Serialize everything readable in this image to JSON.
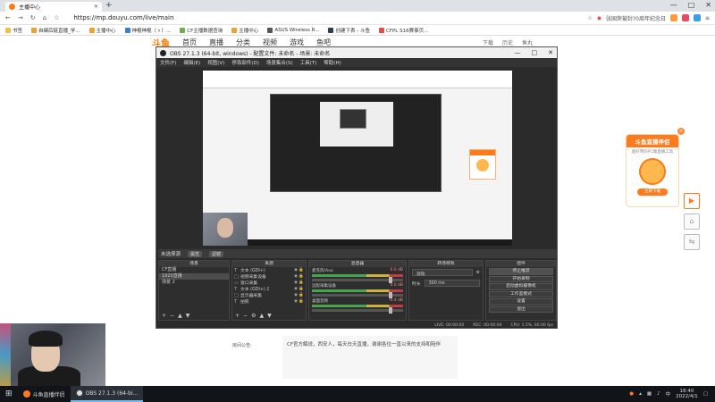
{
  "browser": {
    "tab_title": "主播中心",
    "new_tab": "+",
    "url": "https://mp.douyu.com/live/main",
    "right_text": "张国荣被封?0周年纪念日",
    "window_controls": [
      "—",
      "□",
      "✕"
    ],
    "bookmarks": [
      "书签",
      "自编后链直播_学...",
      "主播中心",
      "神棍神棍（ゝ）...",
      "CF主播数据查询",
      "主播中心",
      "ASUS Wireless R...",
      "创建下表 - 斗鱼",
      "CFPL S16赛事页..."
    ]
  },
  "douyu": {
    "logo": "斗鱼",
    "nav": [
      "首页",
      "直播",
      "分类",
      "视频",
      "游戏",
      "鱼吧"
    ],
    "user_links": [
      "下载",
      "历史",
      "鱼丸"
    ],
    "announcement_label": "房间公告:",
    "announcement_text": "CF官方解说，西安人，每天白天直播，谢谢各位一直以来的支持和陪伴",
    "side_ad_title": "斗鱼直播伴侣",
    "side_ad_sub": "超好用的PC端直播工具",
    "side_ad_btn": "立即下载",
    "side_ad_close": "×",
    "side_buttons": [
      "▶",
      "⌂",
      "⇆"
    ]
  },
  "obs": {
    "title": "OBS 27.1.3 (64-bit, windows) - 配置文件: 未命名 - 场景: 未命名",
    "controls": [
      "—",
      "□",
      "✕"
    ],
    "menu": [
      "文件(F)",
      "编辑(E)",
      "视图(V)",
      "停靠部件(D)",
      "场景集合(S)",
      "工具(T)",
      "帮助(H)"
    ],
    "status_label": "未选择源",
    "chips": [
      "属性",
      "滤镜"
    ],
    "scenes_title": "场景",
    "scenes": [
      "CF直播",
      "1920直播",
      "场景 2"
    ],
    "sources_title": "来源",
    "sources": [
      {
        "icon": "T",
        "name": "文本 (GDI+)"
      },
      {
        "icon": "□",
        "name": "视频采集设备"
      },
      {
        "icon": "▭",
        "name": "窗口采集"
      },
      {
        "icon": "T",
        "name": "文本 (GDI+) 2"
      },
      {
        "icon": "□",
        "name": "显示器采集"
      },
      {
        "icon": "T",
        "name": "拍照"
      }
    ],
    "mixer_title": "混音器",
    "mixer": [
      {
        "name": "麦克风/Aux",
        "db": "0.0 dB"
      },
      {
        "name": "远程采集设备",
        "db": "0.0 dB"
      },
      {
        "name": "桌面音频",
        "db": "-0.4 dB"
      }
    ],
    "trans_title": "转场特效",
    "trans_value": "渐隐",
    "trans_duration_label": "时长",
    "trans_duration": "300 ms",
    "controls_title": "控件",
    "control_buttons": [
      "停止推流",
      "开始录制",
      "启动虚拟摄像机",
      "工作室模式",
      "设置",
      "退出"
    ],
    "statusbar": [
      "LIVE: 00:00:00",
      "REC: 00:00:00",
      "CPU: 1.5%, 60.00 fps"
    ]
  },
  "taskbar": {
    "items": [
      "斗鱼直播伴侣",
      "OBS 27.1.3 (64-bi..."
    ],
    "time": "18:40",
    "date": "2022/4/1"
  }
}
